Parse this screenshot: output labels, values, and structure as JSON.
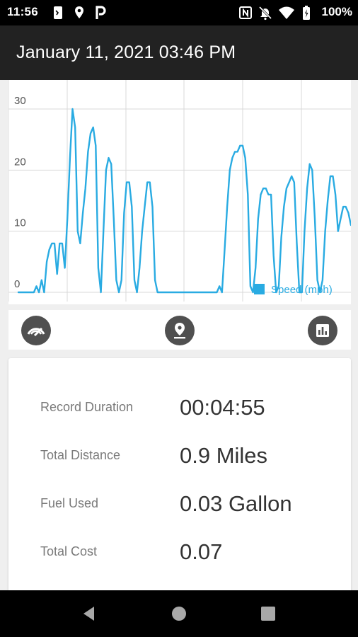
{
  "status_bar": {
    "time": "11:56",
    "battery_text": "100%",
    "left_icons": [
      "phone-icon",
      "location-icon",
      "parking-icon"
    ],
    "right_icons": [
      "nfc-icon",
      "bell-off-icon",
      "wifi-icon",
      "battery-icon"
    ]
  },
  "app_bar": {
    "title": "January 11, 2021 03:46 PM"
  },
  "chart_data": {
    "type": "line",
    "title": "",
    "xlabel": "",
    "ylabel": "",
    "ylim": [
      0,
      31
    ],
    "yticks": [
      "0",
      "10",
      "20",
      "30"
    ],
    "grid": true,
    "legend_position": "bottom-right",
    "series": [
      {
        "name": "Speed (mph)",
        "color": "#29abe2",
        "y": [
          0,
          0,
          0,
          0,
          0,
          0,
          0,
          1,
          0,
          2,
          0,
          5,
          7,
          8,
          8,
          3,
          8,
          8,
          4,
          12,
          22,
          30,
          27,
          10,
          8,
          13,
          17,
          23,
          26,
          27,
          24,
          4,
          0,
          10,
          20,
          22,
          21,
          12,
          2,
          0,
          2,
          13,
          18,
          18,
          14,
          2,
          0,
          4,
          10,
          14,
          18,
          18,
          14,
          2,
          0,
          0,
          0,
          0,
          0,
          0,
          0,
          0,
          0,
          0,
          0,
          0,
          0,
          0,
          0,
          0,
          0,
          0,
          0,
          0,
          0,
          0,
          0,
          0,
          1,
          0,
          7,
          14,
          20,
          22,
          23,
          23,
          24,
          24,
          22,
          16,
          1,
          0,
          4,
          12,
          16,
          17,
          17,
          16,
          16,
          6,
          0,
          1,
          9,
          14,
          17,
          18,
          19,
          18,
          8,
          0,
          0,
          10,
          17,
          21,
          20,
          12,
          2,
          0,
          2,
          10,
          15,
          19,
          19,
          16,
          10,
          12,
          14,
          14,
          13,
          11
        ]
      }
    ]
  },
  "tabs": [
    {
      "name": "speed",
      "icon": "gauge-icon"
    },
    {
      "name": "map",
      "icon": "map-pin-icon"
    },
    {
      "name": "stats",
      "icon": "bar-chart-icon"
    }
  ],
  "stats": [
    {
      "label": "Record Duration",
      "value": "00:04:55"
    },
    {
      "label": "Total Distance",
      "value": "0.9 Miles"
    },
    {
      "label": "Fuel Used",
      "value": "0.03 Gallon"
    },
    {
      "label": "Total Cost",
      "value": "0.07"
    }
  ],
  "nav_bar": {
    "buttons": [
      "back-icon",
      "home-icon",
      "recents-icon"
    ]
  }
}
